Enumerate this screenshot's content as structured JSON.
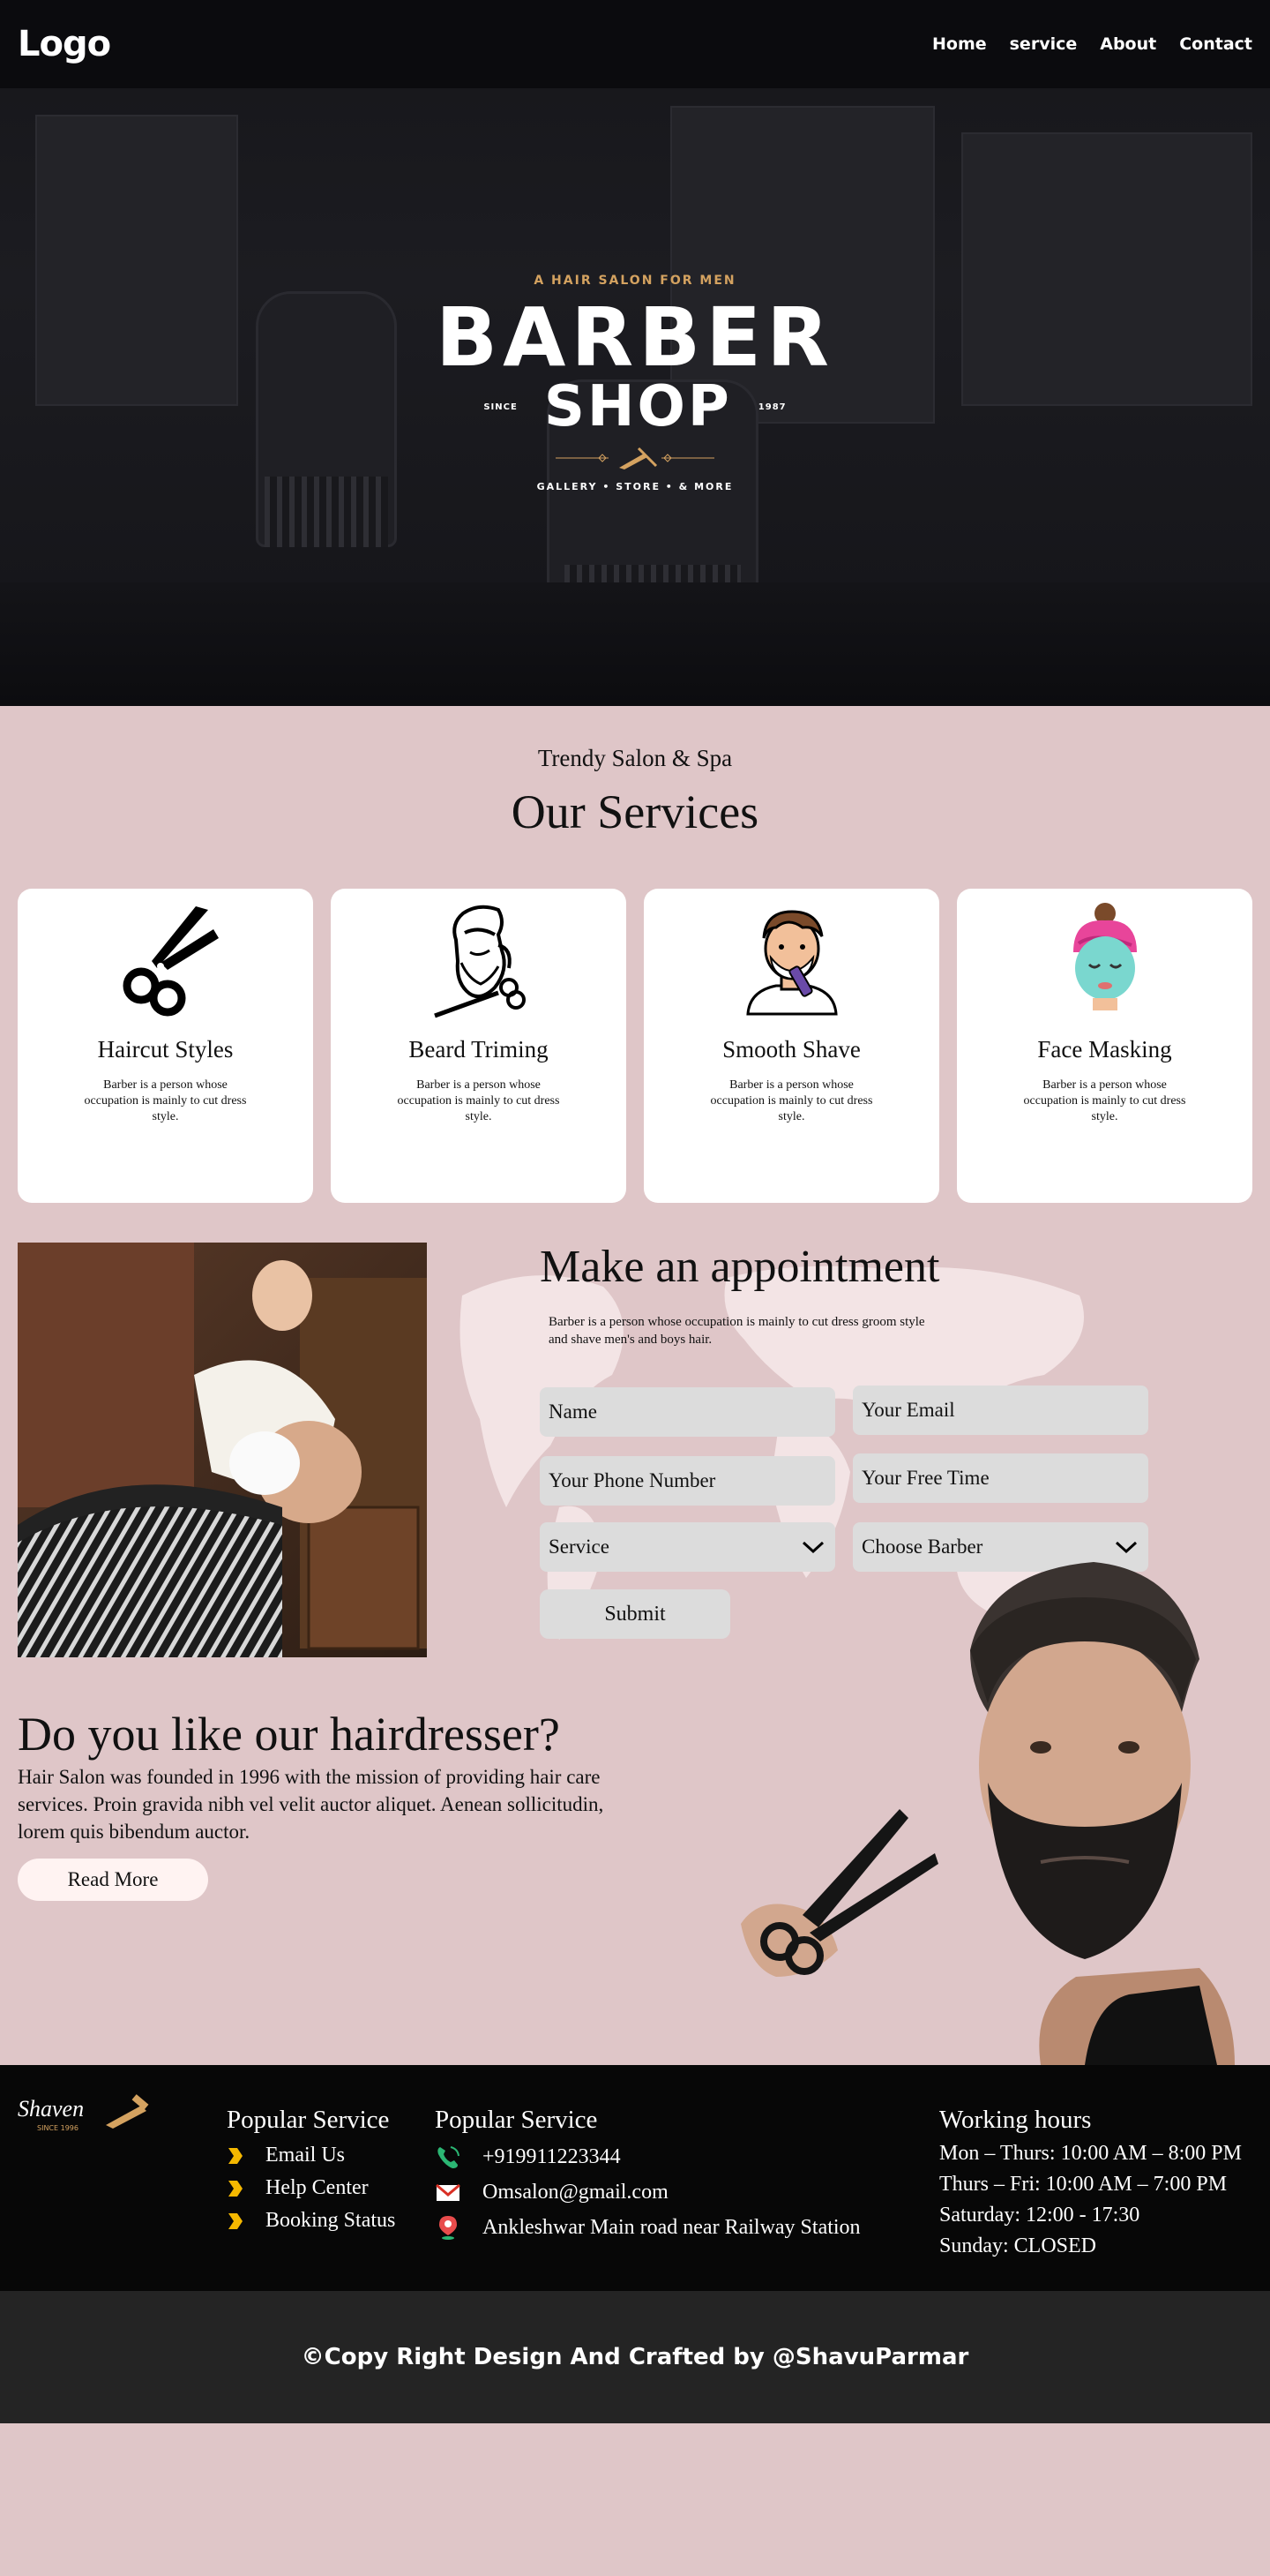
{
  "header": {
    "logo": "Logo",
    "nav": [
      "Home",
      "service",
      "About",
      "Contact"
    ]
  },
  "hero": {
    "tagline": "A HAIR SALON FOR MEN",
    "title_line1": "BARBER",
    "title_line2": "SHOP",
    "since_label": "SINCE",
    "since_year": "1987",
    "subtext": "GALLERY • STORE • & MORE"
  },
  "services": {
    "eyebrow": "Trendy Salon & Spa",
    "title": "Our Services",
    "cards": [
      {
        "icon": "scissors-icon",
        "title": "Haircut Styles",
        "text": "Barber is a person whose occupation is mainly to cut dress style."
      },
      {
        "icon": "beard-trim-icon",
        "title": "Beard Triming",
        "text": "Barber is a person whose occupation is mainly to cut dress style."
      },
      {
        "icon": "shaving-man-icon",
        "title": "Smooth Shave",
        "text": "Barber is a person whose occupation is mainly to cut dress style."
      },
      {
        "icon": "face-mask-woman-icon",
        "title": "Face Masking",
        "text": "Barber is a person whose occupation is mainly to cut dress style."
      }
    ]
  },
  "appointment": {
    "title": "Make an appointment",
    "description": "Barber is a person whose occupation is mainly to cut dress groom style and shave men's and boys hair.",
    "fields": {
      "name": "Name",
      "email": "Your Email",
      "phone": "Your Phone Number",
      "free_time": "Your Free Time",
      "service": "Service",
      "barber": "Choose Barber"
    },
    "submit": "Submit"
  },
  "hairdresser": {
    "title": "Do you like our hairdresser?",
    "text": "Hair Salon was founded in 1996 with the mission of providing hair care services. Proin gravida nibh vel velit auctor aliquet. Aenean sollicitudin, lorem quis bibendum auctor.",
    "button": "Read More"
  },
  "footer": {
    "logo_text": "Shaven",
    "logo_since": "SINCE 1996",
    "col1_title": "Popular Service",
    "col1_links": [
      "Email Us",
      "Help Center",
      "Booking Status"
    ],
    "col2_title": "Popular Service",
    "phone": "+919911223344",
    "email": "Omsalon@gmail.com",
    "address": "Ankleshwar Main road near Railway Station",
    "hours_title": "Working hours",
    "hours": [
      "Mon – Thurs: 10:00 AM – 8:00 PM",
      "Thurs – Fri: 10:00 AM – 7:00 PM",
      "Saturday: 12:00 - 17:30",
      "Sunday: CLOSED"
    ],
    "copyright": "©Copy Right Design And Crafted by @ShavuParmar"
  },
  "colors": {
    "page_bg": "#dfc6c8",
    "header_bg": "#0b0b0e",
    "footer_bg": "#070707",
    "copyright_bg": "#242424",
    "accent": "#d4a260",
    "arrow": "#f5b800"
  }
}
